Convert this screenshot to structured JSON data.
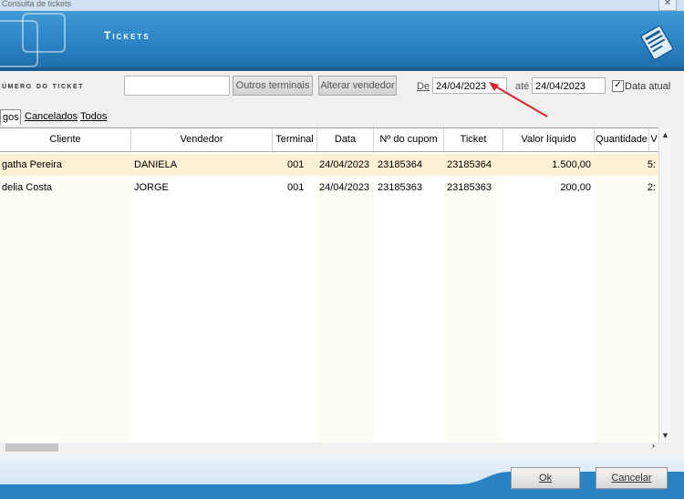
{
  "window": {
    "title": "Consulta de tickets",
    "close_label": "✕"
  },
  "banner": {
    "title": "Tickets"
  },
  "toolbar": {
    "numero_label": "úmero do ticket",
    "numero_value": "",
    "outros_label": "Outros terminais",
    "alterar_label": "Alterar vendedor",
    "de_label": "De",
    "de_value": "24/04/2023",
    "ate_label": "até",
    "ate_value": "24/04/2023",
    "data_atual_label": "Data atual",
    "data_atual_checked": true
  },
  "tabs": [
    "gos",
    "Cancelados",
    "Todos"
  ],
  "table": {
    "columns": [
      "Cliente",
      "Vendedor",
      "Terminal",
      "Data",
      "Nº do cupom",
      "Ticket",
      "Valor líquido",
      "Quantidade",
      "V"
    ],
    "rows": [
      {
        "cliente": "gatha Pereira",
        "vendedor": "DANIELA",
        "terminal": "001",
        "data": "24/04/2023",
        "cupom": "23185364",
        "ticket": "23185364",
        "valor": "1.500,00",
        "quantidade": "5:"
      },
      {
        "cliente": "delia Costa",
        "vendedor": "JORGE",
        "terminal": "001",
        "data": "24/04/2023",
        "cupom": "23185363",
        "ticket": "23185363",
        "valor": "200,00",
        "quantidade": "2:"
      }
    ]
  },
  "footer": {
    "ok_label": "Ok",
    "cancel_label": "Cancelar"
  },
  "colors": {
    "banner": "#2a82c3",
    "selected_row": "#fbf0d4",
    "arrow": "#d6262b"
  }
}
